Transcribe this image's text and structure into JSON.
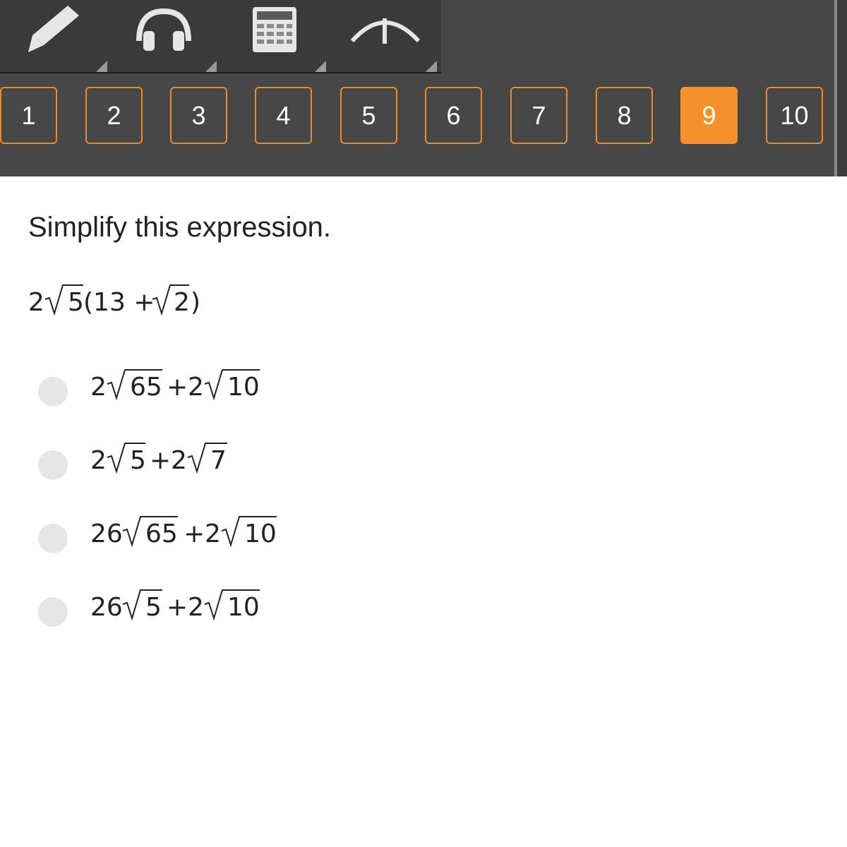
{
  "toolbar": {
    "tools": [
      {
        "icon": "pencil-icon"
      },
      {
        "icon": "headphones-icon"
      },
      {
        "icon": "calculator-icon"
      },
      {
        "icon": "compass-icon"
      }
    ]
  },
  "question_nav": {
    "items": [
      "1",
      "2",
      "3",
      "4",
      "5",
      "6",
      "7",
      "8",
      "9",
      "10"
    ],
    "active": "9",
    "accent_color": "#f5912b"
  },
  "question": {
    "prompt": "Simplify this expression.",
    "expression": {
      "coef": "2",
      "rad": "5",
      "open": "(13 +",
      "rad2": "2",
      "close": ")"
    }
  },
  "choices": [
    {
      "a_coef": "2",
      "a_rad": "65",
      "op": "+",
      "b_coef": "2",
      "b_rad": "10"
    },
    {
      "a_coef": "2",
      "a_rad": "5",
      "op": "+",
      "b_coef": "2",
      "b_rad": "7"
    },
    {
      "a_coef": "26",
      "a_rad": "65",
      "op": "+",
      "b_coef": "2",
      "b_rad": "10"
    },
    {
      "a_coef": "26",
      "a_rad": "5",
      "op": "+",
      "b_coef": "2",
      "b_rad": "10"
    }
  ]
}
